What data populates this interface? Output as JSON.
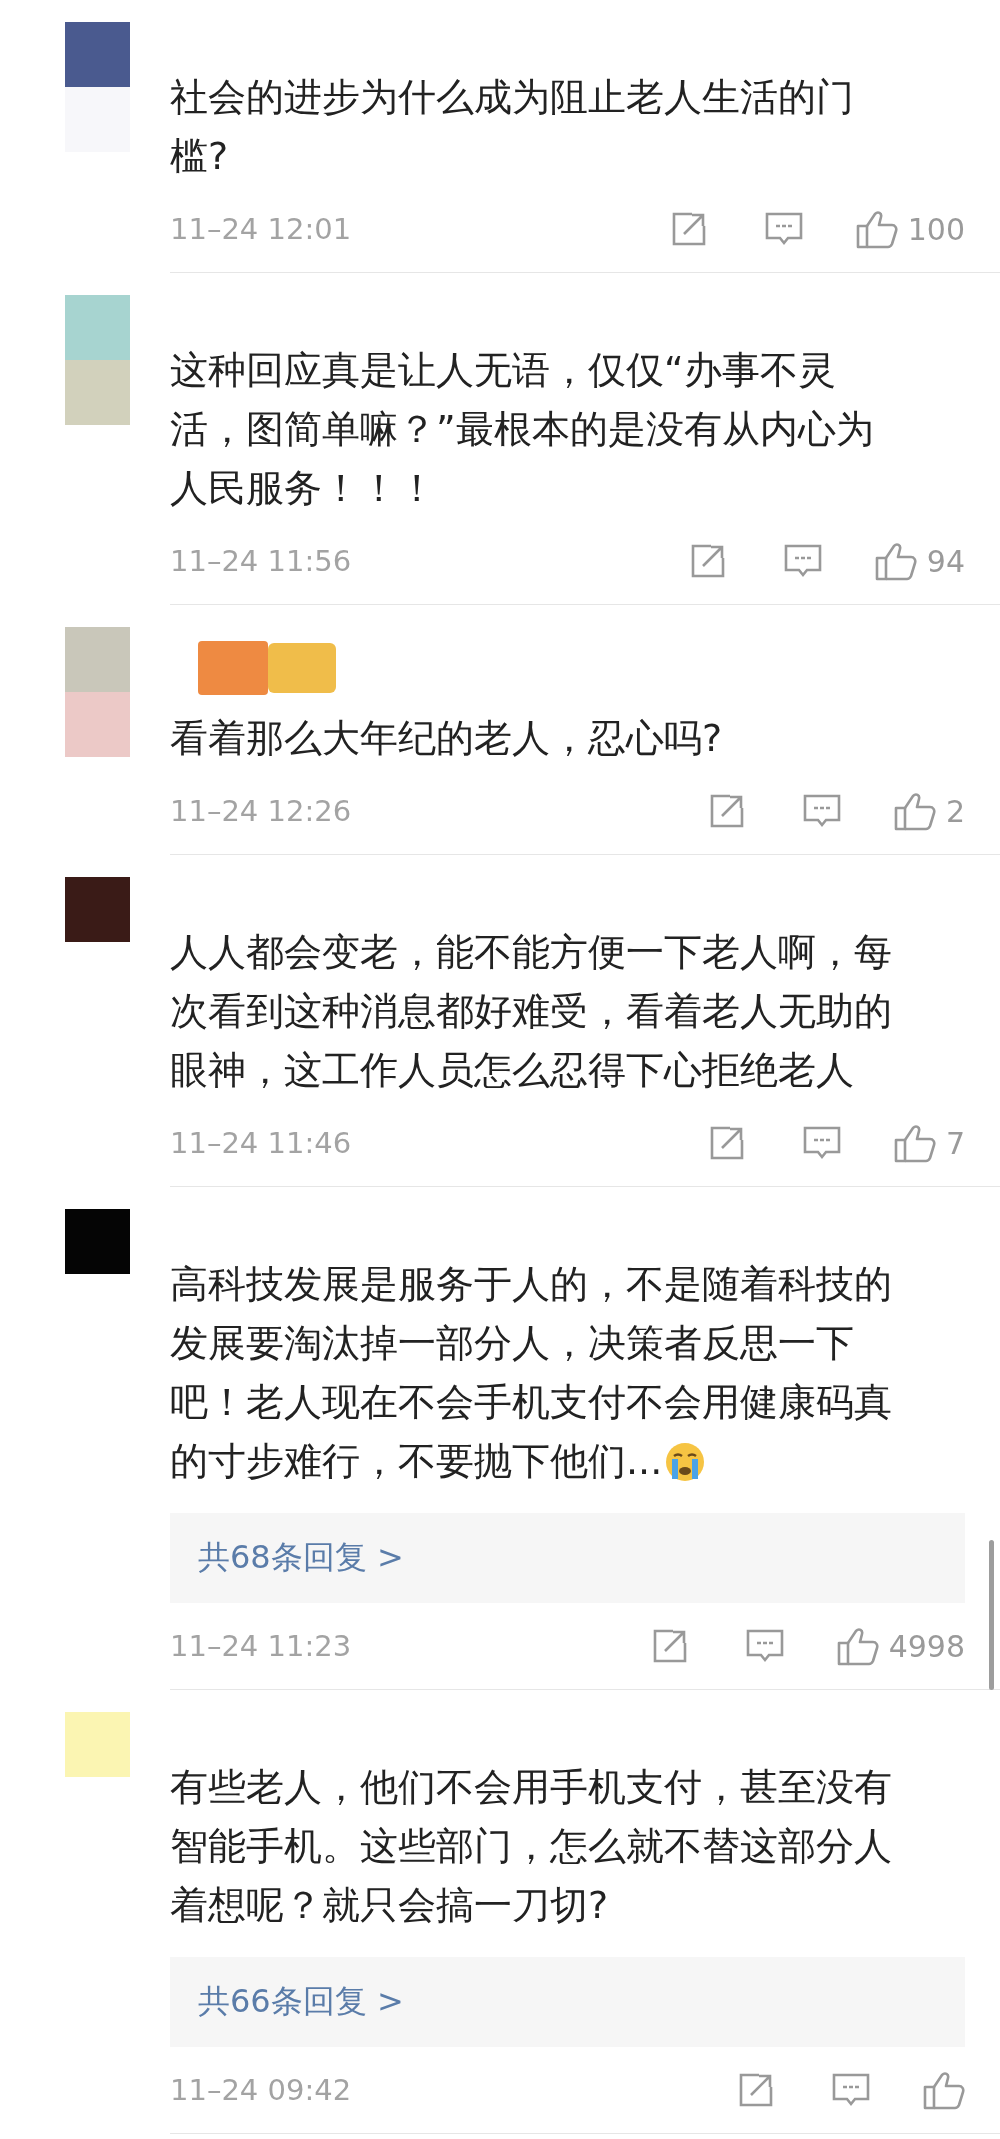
{
  "comments": [
    {
      "lines": [
        "社会的进步为什么成为阻止老人生活的门",
        "槛?"
      ],
      "time": "11–24 12:01",
      "likes": "100"
    },
    {
      "lines": [
        "这种回应真是让人无语，仅仅“办事不灵",
        "活，图简单嘛？”最根本的是没有从内心为",
        "人民服务！！！"
      ],
      "time": "11–24 11:56",
      "likes": "94"
    },
    {
      "name": {
        "kind": "picture"
      },
      "lines": [
        "看着那么大年纪的老人，忍心吗?"
      ],
      "time": "11–24 12:26",
      "likes": "2"
    },
    {
      "lines": [
        "人人都会变老，能不能方便一下老人啊，每",
        "次看到这种消息都好难受，看着老人无助的",
        "眼神，这工作人员怎么忍得下心拒绝老人"
      ],
      "time": "11–24 11:46",
      "likes": "7"
    },
    {
      "lines": [
        "高科技发展是服务于人的，不是随着科技的",
        "发展要淘汰掉一部分人，决策者反思一下",
        "吧！老人现在不会手机支付不会用健康码真",
        "的寸步难行，不要抛下他们..."
      ],
      "crying_emoji": true,
      "replies": "共68条回复 >",
      "time": "11–24 11:23",
      "likes": "4998"
    },
    {
      "lines": [
        "有些老人，他们不会用手机支付，甚至没有",
        "智能手机。这些部门，怎么就不替这部分人",
        "着想呢？就只会搞一刀切?"
      ],
      "replies": "共66条回复 >",
      "time": "11–24 09:42"
    }
  ]
}
